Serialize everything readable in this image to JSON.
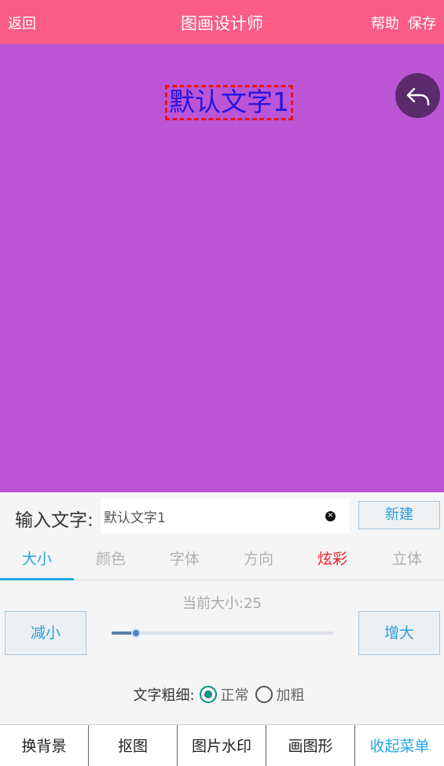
{
  "header": {
    "back_label": "返回",
    "title": "图画设计师",
    "help_label": "帮助",
    "save_label": "保存",
    "bg_color": "#fb5c86"
  },
  "canvas": {
    "bg_color": "#bb55d6",
    "text": "默认文字1",
    "text_color": "#2415e0",
    "undo_icon": "undo-arrow-icon"
  },
  "editor": {
    "input_label": "输入文字:",
    "input_value": "默认文字1",
    "clear_icon": "clear-icon",
    "new_button": "新建",
    "tabs": [
      {
        "label": "大小",
        "state": "active"
      },
      {
        "label": "颜色",
        "state": "normal"
      },
      {
        "label": "字体",
        "state": "normal"
      },
      {
        "label": "方向",
        "state": "normal"
      },
      {
        "label": "炫彩",
        "state": "highlight"
      },
      {
        "label": "立体",
        "state": "normal"
      }
    ],
    "size_label": "当前大小:25",
    "decrease_button": "减小",
    "increase_button": "增大",
    "slider_fraction": 0.11,
    "weight_label": "文字粗细:",
    "weight_options": [
      {
        "label": "正常",
        "checked": true
      },
      {
        "label": "加粗",
        "checked": false
      }
    ]
  },
  "bottom_nav": {
    "items": [
      {
        "label": "换背景"
      },
      {
        "label": "抠图"
      },
      {
        "label": "图片水印"
      },
      {
        "label": "画图形"
      },
      {
        "label": "收起菜单"
      }
    ]
  }
}
